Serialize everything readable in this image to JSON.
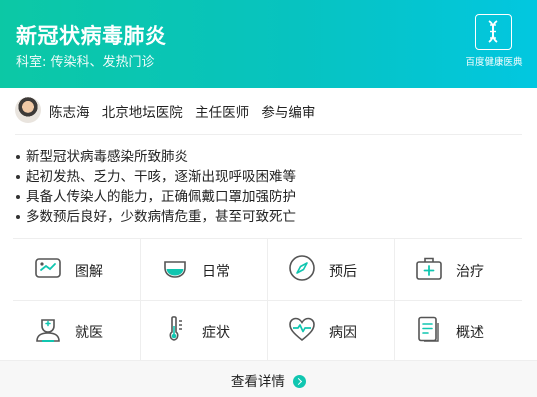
{
  "header": {
    "title": "新冠状病毒肺炎",
    "department": "科室: 传染科、发热门诊",
    "logo_text": "百度健康医典",
    "logo_icon": "dna-book-icon"
  },
  "doctor": {
    "name": "陈志海",
    "hospital": "北京地坛医院",
    "title": "主任医师",
    "role": "参与编审"
  },
  "bullets": [
    "新型冠状病毒感染所致肺炎",
    "起初发热、乏力、干咳，逐渐出现呼吸困难等",
    "具备人传染人的能力，正确佩戴口罩加强防护",
    "多数预后良好，少数病情危重，甚至可致死亡"
  ],
  "grid": [
    {
      "label": "图解",
      "icon": "image-icon"
    },
    {
      "label": "日常",
      "icon": "cup-icon"
    },
    {
      "label": "预后",
      "icon": "compass-icon"
    },
    {
      "label": "治疗",
      "icon": "medical-kit-icon"
    },
    {
      "label": "就医",
      "icon": "doctor-icon"
    },
    {
      "label": "症状",
      "icon": "thermometer-icon"
    },
    {
      "label": "病因",
      "icon": "heartbeat-icon"
    },
    {
      "label": "概述",
      "icon": "document-icon"
    }
  ],
  "footer": {
    "label": "查看详情",
    "icon": "chevron-right-icon"
  },
  "colors": {
    "accent": "#0fc4b5",
    "header_start": "#0cc8a5",
    "header_end": "#02c7e0",
    "icon_stroke": "#555555",
    "footer_bg": "#f7f7f7"
  }
}
